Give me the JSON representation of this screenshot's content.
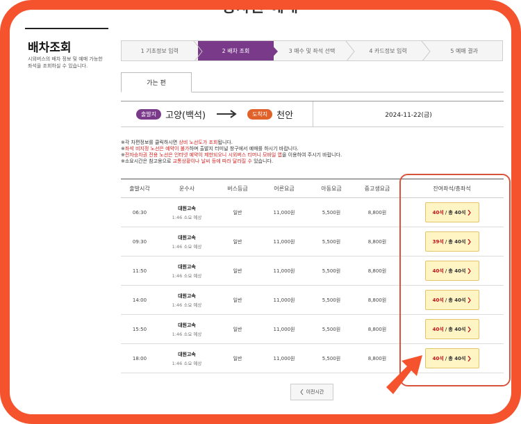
{
  "page_title": "승차권 예매",
  "left": {
    "title": "배차조회",
    "description": "시외버스의 배차 정보 및 예매 가능한 좌석을 조회하실 수 있습니다."
  },
  "steps": [
    {
      "label": "1 기초정보 입력",
      "active": false
    },
    {
      "label": "2 배차 조회",
      "active": true
    },
    {
      "label": "3 매수 및 좌석 선택",
      "active": false
    },
    {
      "label": "4 카드정보 입력",
      "active": false
    },
    {
      "label": "5 예매 결과",
      "active": false
    }
  ],
  "tab_label": "가는 편",
  "route": {
    "departure_badge": "출발지",
    "departure": "고양(백석)",
    "arrival_badge": "도착지",
    "arrival": "천안",
    "date": "2024-11-22(금)"
  },
  "notices": [
    {
      "prefix": "※각 차편정보를 클릭하시면 ",
      "red": "상비 노선도가 조회",
      "suffix": "됩니다."
    },
    {
      "prefix": "※",
      "red": "좌석 비지정 노선은 예약이 불가",
      "suffix": "하며 출발지 터미널 창구에서 예매를 하시기 바랍니다."
    },
    {
      "prefix": "※",
      "red": "전자승차권 전용 노선은 인터넷 예약이 제한되오니 시외버스 티머니 모바일 앱",
      "suffix": "을 이용하여 주시기 바랍니다."
    },
    {
      "prefix": "※소요시간은 참고용으로 ",
      "red": "교통상황이나 날씨 등에 따라 달라질 수",
      "suffix": " 있습니다."
    }
  ],
  "table": {
    "headers": [
      "출발시각",
      "운수사",
      "버스등급",
      "어른요금",
      "아동요금",
      "중고생요금",
      "잔여좌석/총좌석"
    ],
    "rows": [
      {
        "time": "06:30",
        "company": "대원고속",
        "duration": "1:46 소요 예상",
        "grade": "일반",
        "adult": "11,000원",
        "child": "5,500원",
        "student": "8,800원",
        "remaining": "40석",
        "total": "총 40석"
      },
      {
        "time": "09:30",
        "company": "대원고속",
        "duration": "1:46 소요 예상",
        "grade": "일반",
        "adult": "11,000원",
        "child": "5,500원",
        "student": "8,800원",
        "remaining": "39석",
        "total": "총 40석"
      },
      {
        "time": "11:50",
        "company": "대원고속",
        "duration": "1:46 소요 예상",
        "grade": "일반",
        "adult": "11,000원",
        "child": "5,500원",
        "student": "8,800원",
        "remaining": "40석",
        "total": "총 40석"
      },
      {
        "time": "14:00",
        "company": "대원고속",
        "duration": "1:46 소요 예상",
        "grade": "일반",
        "adult": "11,000원",
        "child": "5,500원",
        "student": "8,800원",
        "remaining": "40석",
        "total": "총 40석"
      },
      {
        "time": "15:50",
        "company": "대원고속",
        "duration": "1:46 소요 예상",
        "grade": "일반",
        "adult": "11,000원",
        "child": "5,500원",
        "student": "8,800원",
        "remaining": "40석",
        "total": "총 40석"
      },
      {
        "time": "18:00",
        "company": "대원고속",
        "duration": "1:46 소요 예상",
        "grade": "일반",
        "adult": "11,000원",
        "child": "5,500원",
        "student": "8,800원",
        "remaining": "40석",
        "total": "총 40석"
      }
    ]
  },
  "prev_button": "이전시간",
  "colors": {
    "frame": "#f4532e",
    "accent": "#7a3a8a",
    "arrival": "#e0622a",
    "seat_button": "#fff4c4",
    "seat_text": "#c0141a",
    "highlight": "#d9533a"
  },
  "icons": {
    "route_arrow": "long-right-arrow-icon",
    "seat_chevron": "chevron-right-icon",
    "prev_chevron": "chevron-left-icon",
    "annotation": "big-pointer-arrow-icon"
  }
}
